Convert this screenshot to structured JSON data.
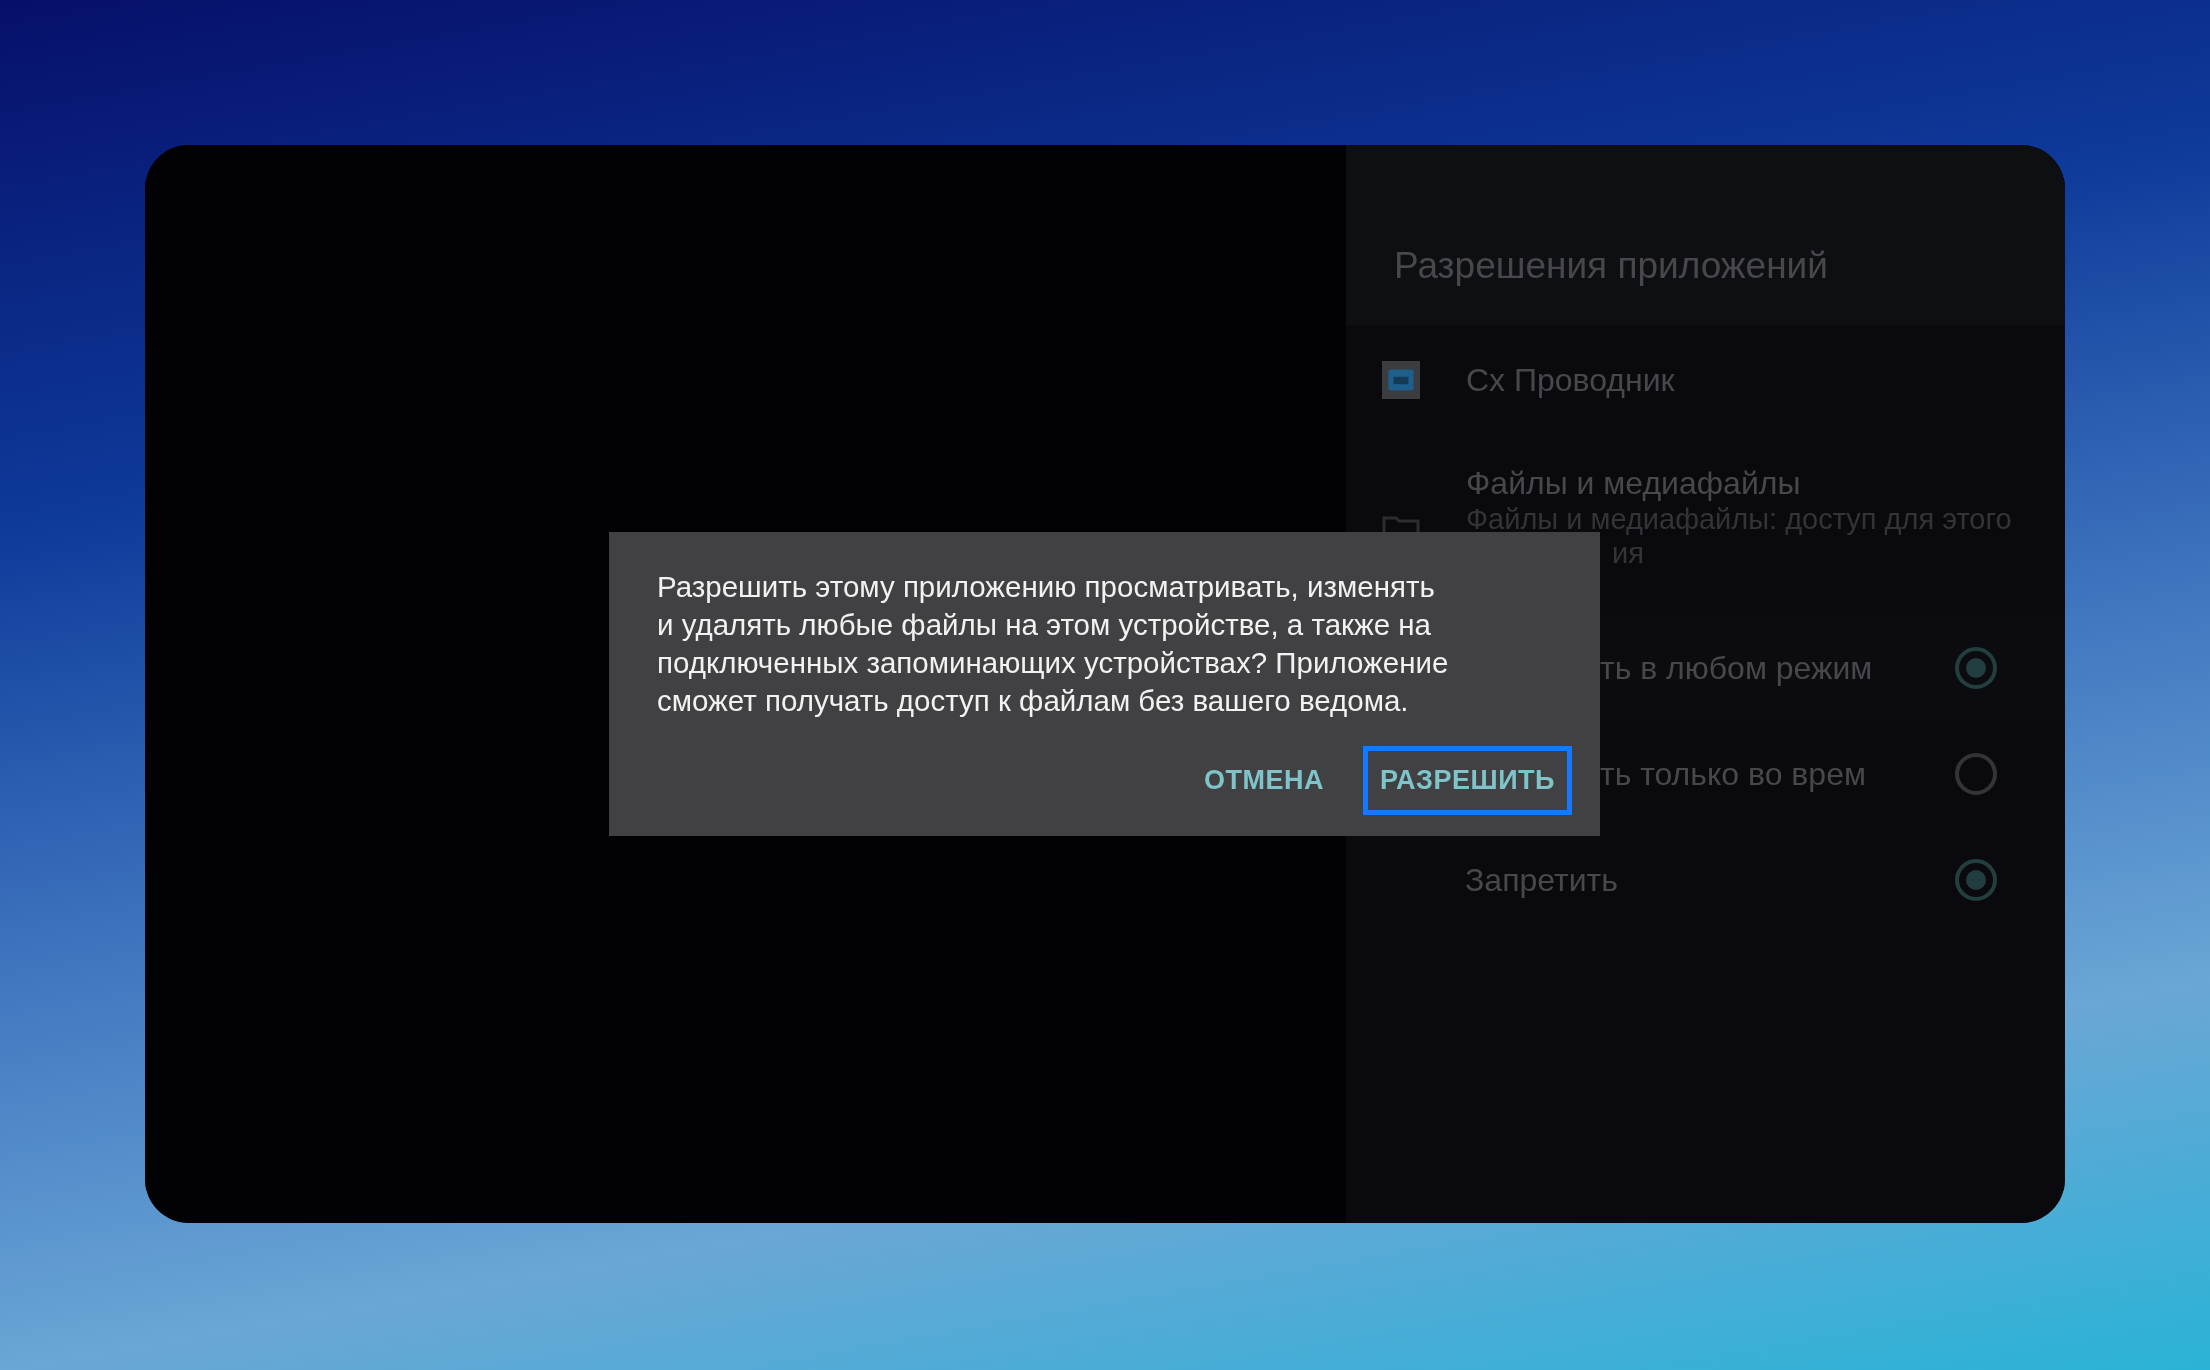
{
  "panel": {
    "title": "Разрешения приложений",
    "app": {
      "name": "Cx Проводник"
    },
    "permission": {
      "title": "Файлы и медиафайлы",
      "subtitle": [
        "Файлы и медиафайлы: доступ для этого",
        "ия"
      ]
    },
    "options": [
      {
        "label": "ть в любом режим",
        "selected": true
      },
      {
        "label": "ть только во врем",
        "selected": false
      },
      {
        "label": "Запретить",
        "selected": true
      }
    ]
  },
  "dialog": {
    "message": "Разрешить этому приложению просматривать, изменять и удалять любые файлы на этом устройстве, а также на подключенных запоминающих устройствах? Приложение сможет получать доступ к файлам без вашего ведома.",
    "buttons": [
      {
        "label": "ОТМЕНА",
        "focused": false
      },
      {
        "label": "РАЗРЕШИТЬ",
        "focused": true
      }
    ]
  }
}
